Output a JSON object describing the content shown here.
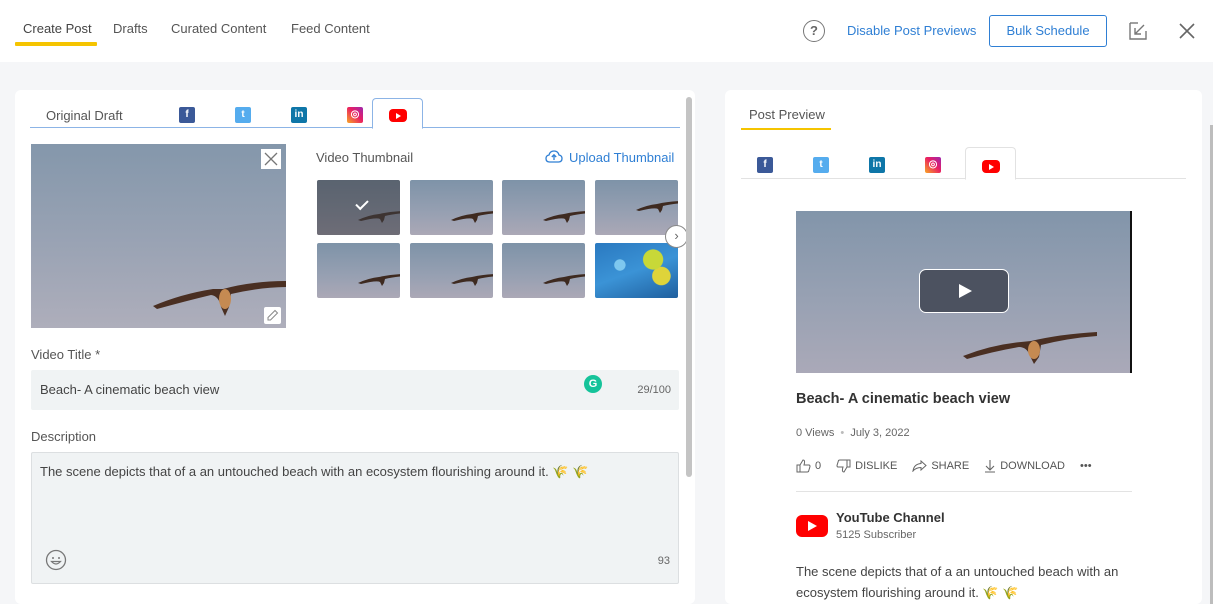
{
  "nav": {
    "tabs": [
      {
        "label": "Create Post",
        "active": true
      },
      {
        "label": "Drafts",
        "active": false
      },
      {
        "label": "Curated Content",
        "active": false
      },
      {
        "label": "Feed Content",
        "active": false
      }
    ],
    "help_icon": "?",
    "disable_previews_label": "Disable Post Previews",
    "bulk_schedule_label": "Bulk Schedule",
    "accent_color": "#f5c400",
    "link_color": "#2f7fd4"
  },
  "editor": {
    "tabs": [
      {
        "label": "Original Draft"
      },
      {
        "icon": "facebook-icon",
        "glyph": "f"
      },
      {
        "icon": "twitter-icon",
        "glyph": "t"
      },
      {
        "icon": "linkedin-icon",
        "glyph": "in"
      },
      {
        "icon": "instagram-icon",
        "glyph": "◎"
      },
      {
        "icon": "youtube-icon",
        "active": true
      }
    ],
    "thumbnail_section_label": "Video Thumbnail",
    "upload_thumbnail_label": "Upload Thumbnail",
    "thumbnails": [
      {
        "kind": "bird",
        "selected": true
      },
      {
        "kind": "bird",
        "selected": false
      },
      {
        "kind": "bird",
        "selected": false
      },
      {
        "kind": "bird",
        "selected": false
      },
      {
        "kind": "bird",
        "selected": false
      },
      {
        "kind": "bird",
        "selected": false
      },
      {
        "kind": "bird",
        "selected": false
      },
      {
        "kind": "flowers",
        "selected": false
      }
    ],
    "video_title_label": "Video Title *",
    "video_title_value": "Beach- A cinematic beach view",
    "video_title_counter": "29/100",
    "grammarly_glyph": "G",
    "description_label": "Description",
    "description_value": "The scene depicts that of a an untouched beach with an ecosystem flourishing around it. 🌾 🌾",
    "description_counter": "93"
  },
  "preview": {
    "title": "Post Preview",
    "tabs": [
      {
        "icon": "facebook-icon",
        "glyph": "f"
      },
      {
        "icon": "twitter-icon",
        "glyph": "t"
      },
      {
        "icon": "linkedin-icon",
        "glyph": "in"
      },
      {
        "icon": "instagram-icon",
        "glyph": "◎"
      },
      {
        "icon": "youtube-icon",
        "active": true
      }
    ],
    "video_title": "Beach- A cinematic beach view",
    "views": "0 Views",
    "separator": "•",
    "date": "July 3, 2022",
    "likes": "0",
    "dislike_label": "DISLIKE",
    "share_label": "SHARE",
    "download_label": "DOWNLOAD",
    "more_label": "•••",
    "channel_name": "YouTube Channel",
    "subscribers": "5125 Subscriber",
    "description": "The scene depicts that of a an untouched beach with an ecosystem flourishing around it. 🌾 🌾"
  }
}
